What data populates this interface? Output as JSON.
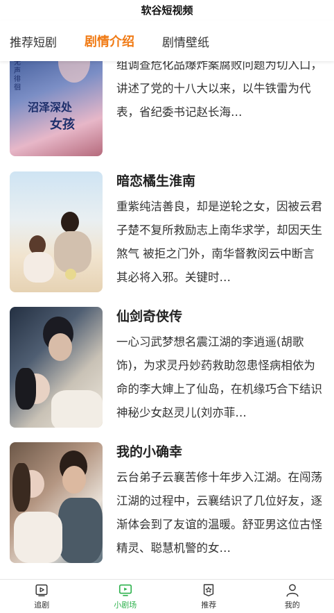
{
  "app": {
    "title": "软谷短视频"
  },
  "tabs": [
    {
      "label": "推荐短剧",
      "active": false
    },
    {
      "label": "剧情介绍",
      "active": true
    },
    {
      "label": "剧情壁纸",
      "active": false
    }
  ],
  "items": [
    {
      "title": "",
      "description": "该剧以东江市纪委书记牛铁雷奉命率专案组调查危化品爆炸案腐败问题为切入口，讲述了党的十八大以来，以牛铁雷为代表，省纪委书记赵长海…",
      "poster_text_a": "沼泽深处",
      "poster_text_b": "女孩",
      "poster_vertical": "中寂寞无声徘徊"
    },
    {
      "title": "暗恋橘生淮南",
      "description": "重紫纯洁善良，却是逆轮之女，因被云君子楚不复所救励志上南华求学，却因天生煞气 被拒之门外，南华督教闵云中断言其必将入邪。关键时…"
    },
    {
      "title": "仙剑奇侠传",
      "description": "一心习武梦想名震江湖的李逍遥(胡歌 饰)，为求灵丹妙药救助忽患怪病相依为命的李大婶上了仙岛，在机缘巧合下结识神秘少女赵灵儿(刘亦菲…"
    },
    {
      "title": "我的小确幸",
      "description": "云台弟子云襄苦修十年步入江湖。在闯荡江湖的过程中，云襄结识了几位好友，逐渐体会到了友谊的温暖。舒亚男这位古怪精灵、聪慧机警的女…"
    }
  ],
  "nav": [
    {
      "label": "追剧",
      "icon": "play-square-icon",
      "active": false
    },
    {
      "label": "小剧场",
      "icon": "tv-icon",
      "active": true
    },
    {
      "label": "推荐",
      "icon": "star-badge-icon",
      "active": false
    },
    {
      "label": "我的",
      "icon": "user-icon",
      "active": false
    }
  ],
  "colors": {
    "accent": "#f07a14",
    "nav_active": "#2fb24e"
  }
}
